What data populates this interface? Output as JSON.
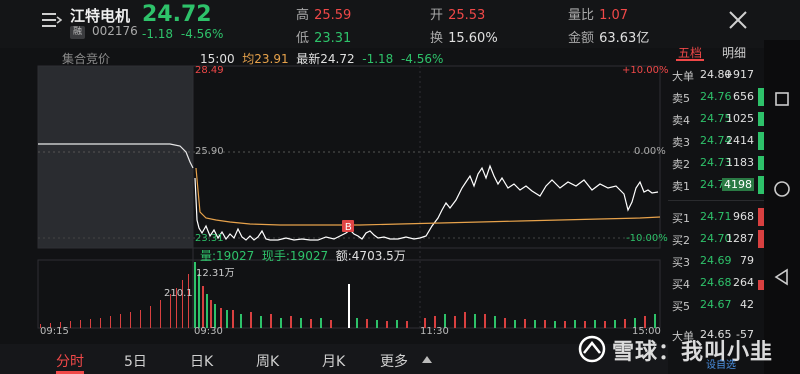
{
  "header": {
    "name": "江特电机",
    "badge": "融",
    "code": "002176",
    "price": "24.72",
    "change": "-1.18",
    "change_pct": "-4.56%",
    "stats": [
      {
        "label": "高",
        "value": "25.59",
        "color": "red"
      },
      {
        "label": "开",
        "value": "25.53",
        "color": "red"
      },
      {
        "label": "量比",
        "value": "1.07",
        "color": "red"
      },
      {
        "label": "低",
        "value": "23.31",
        "color": "green"
      },
      {
        "label": "换",
        "value": "15.60%",
        "color": "white"
      },
      {
        "label": "金额",
        "value": "63.63亿",
        "color": "white"
      }
    ]
  },
  "chart": {
    "auction_label": "集合竞价",
    "info": {
      "time": "15:00",
      "avg_label": "均",
      "avg": "23.91",
      "latest_label": "最新",
      "latest": "24.72",
      "chg": "-1.18",
      "pct": "-4.56%"
    },
    "y_top": "28.49",
    "y_mid": "25.90",
    "y_bot": "23.31",
    "pct_top": "+10.00%",
    "pct_mid": "0.00%",
    "pct_bot": "-10.00%",
    "b_marker": "B",
    "vol_info": {
      "vol_label": "量:",
      "vol": "19027",
      "cur_label": "现手:",
      "cur": "19027",
      "amt_label": "额:",
      "amt": "4703.5万"
    },
    "vol_top": "12.31万",
    "vol_mid": "210.1",
    "times": [
      "09:15",
      "09:30",
      "11:30",
      "15:00"
    ]
  },
  "tabs": [
    "分时",
    "5日",
    "日K",
    "周K",
    "月K",
    "更多"
  ],
  "book": {
    "tabs": [
      "五档",
      "明细"
    ],
    "big_sell": {
      "label": "大单",
      "price": "24.80",
      "vol": "+917"
    },
    "sells": [
      {
        "label": "卖5",
        "price": "24.76",
        "vol": "656"
      },
      {
        "label": "卖4",
        "price": "24.75",
        "vol": "1025"
      },
      {
        "label": "卖3",
        "price": "24.74",
        "vol": "2414"
      },
      {
        "label": "卖2",
        "price": "24.73",
        "vol": "1183"
      },
      {
        "label": "卖1",
        "price": "24.72",
        "vol": "4198"
      }
    ],
    "buys": [
      {
        "label": "买1",
        "price": "24.71",
        "vol": "968"
      },
      {
        "label": "买2",
        "price": "24.70",
        "vol": "1287"
      },
      {
        "label": "买3",
        "price": "24.69",
        "vol": "79"
      },
      {
        "label": "买4",
        "price": "24.68",
        "vol": "264"
      },
      {
        "label": "买5",
        "price": "24.67",
        "vol": "42"
      }
    ],
    "big_buy": {
      "label": "大单",
      "price": "24.65",
      "vol": "-57"
    }
  },
  "watermark": {
    "text": "雪球：我叫小韭",
    "sub": "设自选"
  }
}
